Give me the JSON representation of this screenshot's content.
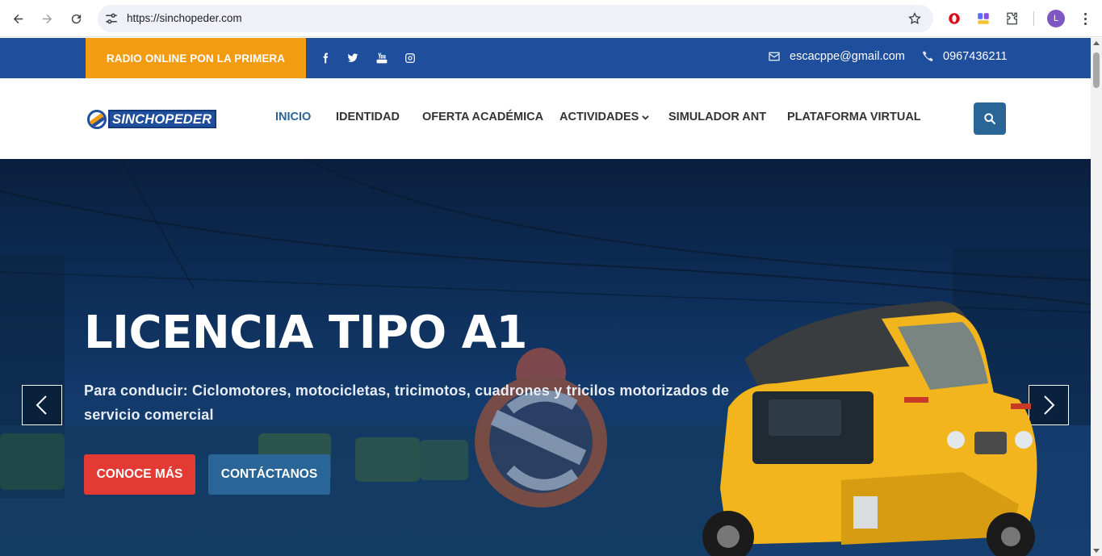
{
  "browser": {
    "url": "https://sinchopeder.com",
    "profile_initial": "L",
    "icons": [
      "back-icon",
      "forward-icon",
      "reload-icon",
      "site-info-icon",
      "bookmark-star-icon",
      "opera-extension-icon",
      "translate-extension-icon",
      "extensions-puzzle-icon",
      "chrome-menu-icon"
    ]
  },
  "topbar": {
    "radio_label": "RADIO ONLINE PON LA PRIMERA",
    "social_icons": [
      "facebook-icon",
      "twitter-icon",
      "youtube-icon",
      "instagram-icon"
    ],
    "email": "escacppe@gmail.com",
    "phone": "0967436211",
    "colors": {
      "bar": "#1f4e9c",
      "radio_box": "#f39c12"
    }
  },
  "navbar": {
    "logo_text": "SINCHOPEDER",
    "items": [
      {
        "label": "INICIO",
        "active": true
      },
      {
        "label": "IDENTIDAD"
      },
      {
        "label": "OFERTA ACADÉMICA"
      },
      {
        "label": "ACTIVIDADES",
        "has_dropdown": true
      },
      {
        "label": "SIMULADOR ANT"
      },
      {
        "label": "PLATAFORMA VIRTUAL"
      }
    ],
    "search_icon": "search-icon",
    "colors": {
      "active": "#2a6597",
      "search_button": "#2a6597"
    }
  },
  "hero": {
    "title": "LICENCIA TIPO A1",
    "description": "Para conducir: Ciclomotores, motocicletas, tricimotos, cuadrones y tricilos motorizados de servicio comercial",
    "primary_button": "CONOCE MÁS",
    "secondary_button": "CONTÁCTANOS",
    "prev_icon": "chevron-left-icon",
    "next_icon": "chevron-right-icon",
    "colors": {
      "primary_button": "#e33b34",
      "secondary_button": "#2a6597"
    }
  }
}
